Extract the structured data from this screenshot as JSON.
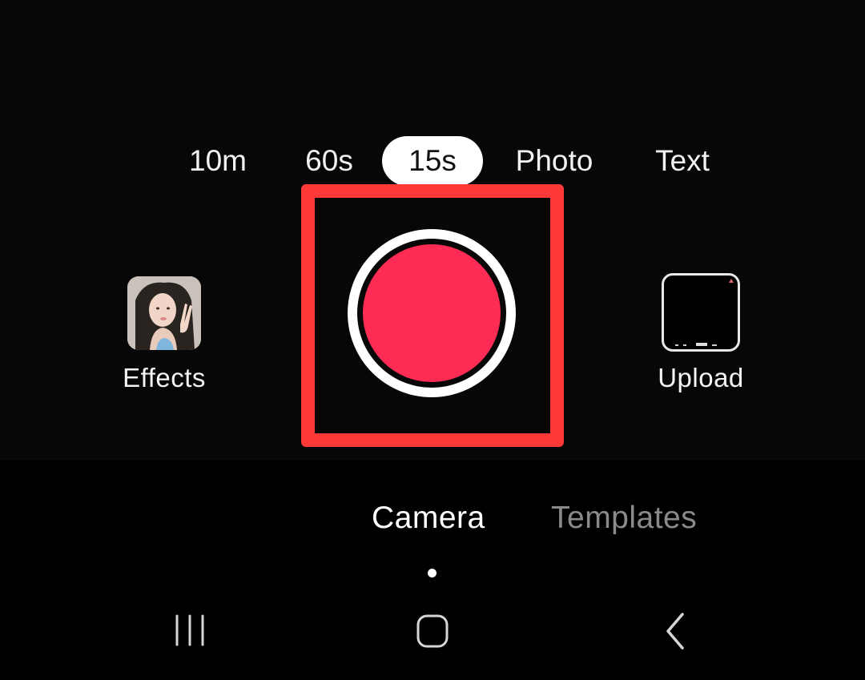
{
  "modes": {
    "items": [
      {
        "label": "10m",
        "selected": false
      },
      {
        "label": "60s",
        "selected": false
      },
      {
        "label": "15s",
        "selected": true
      },
      {
        "label": "Photo",
        "selected": false
      },
      {
        "label": "Text",
        "selected": false
      }
    ]
  },
  "effects": {
    "label": "Effects",
    "icon": "effects-thumbnail-icon"
  },
  "upload": {
    "label": "Upload",
    "icon": "gallery-thumbnail-icon"
  },
  "record": {
    "icon": "record-icon",
    "color": "#fe2c55"
  },
  "highlight": {
    "color": "#ff3838"
  },
  "tabs": {
    "items": [
      {
        "label": "Camera",
        "active": true
      },
      {
        "label": "Templates",
        "active": false
      }
    ]
  },
  "nav": {
    "recents": "recent-apps-icon",
    "home": "home-icon",
    "back": "back-icon"
  }
}
